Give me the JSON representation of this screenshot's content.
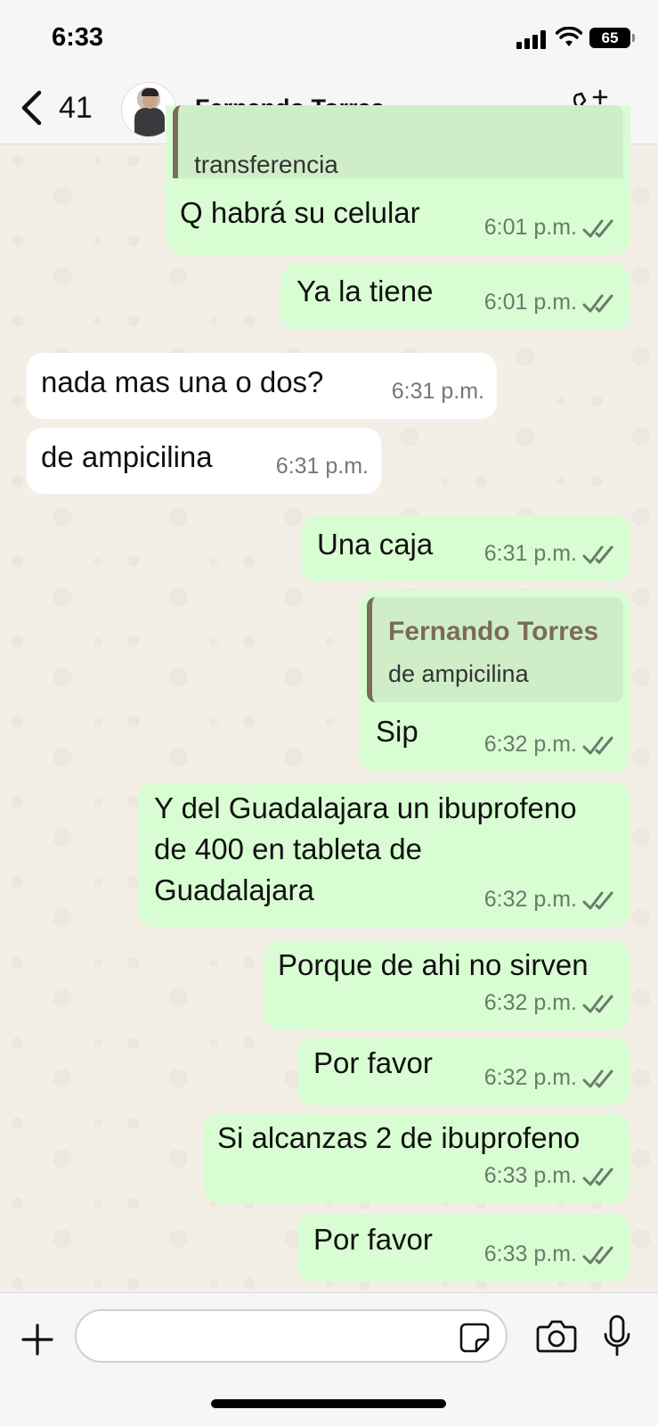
{
  "status_bar": {
    "time": "6:33",
    "battery": "65"
  },
  "header": {
    "back_count": "41",
    "contact_name": "Fernando Torres"
  },
  "messages": [
    {
      "dir": "out",
      "text": "transferencia",
      "time": "",
      "partial": true
    },
    {
      "dir": "out",
      "text": "Q habrá su celular",
      "time": "6:01 p.m."
    },
    {
      "dir": "out",
      "text": "Ya la tiene",
      "time": "6:01 p.m."
    },
    {
      "dir": "in",
      "text": "nada mas una o dos?",
      "time": "6:31 p.m."
    },
    {
      "dir": "in",
      "text": "de ampicilina",
      "time": "6:31 p.m."
    },
    {
      "dir": "out",
      "text": "Una caja",
      "time": "6:31 p.m."
    },
    {
      "dir": "out",
      "quote_name": "Fernando Torres",
      "quote_text": "de ampicilina",
      "text": "Sip",
      "time": "6:32 p.m."
    },
    {
      "dir": "out",
      "text_lines": [
        "Y del Guadalajara un ibuprofeno",
        "de 400 en tableta de",
        "Guadalajara"
      ],
      "time": "6:32 p.m."
    },
    {
      "dir": "out",
      "text": "Porque de ahi no sirven",
      "time": "6:32 p.m."
    },
    {
      "dir": "out",
      "text": "Por favor",
      "time": "6:32 p.m."
    },
    {
      "dir": "out",
      "text": "Si alcanzas 2 de ibuprofeno",
      "time": "6:33 p.m."
    },
    {
      "dir": "out",
      "text": "Por favor",
      "time": "6:33 p.m."
    }
  ],
  "input": {
    "placeholder": ""
  },
  "icons": [
    "back-chevron-icon",
    "call-add-icon",
    "plus-icon",
    "sticker-icon",
    "camera-icon",
    "mic-icon",
    "double-check-icon"
  ],
  "colors": {
    "outgoing": "#d9fdd3",
    "incoming": "#ffffff",
    "read_ticks": "#6b7a6b"
  }
}
